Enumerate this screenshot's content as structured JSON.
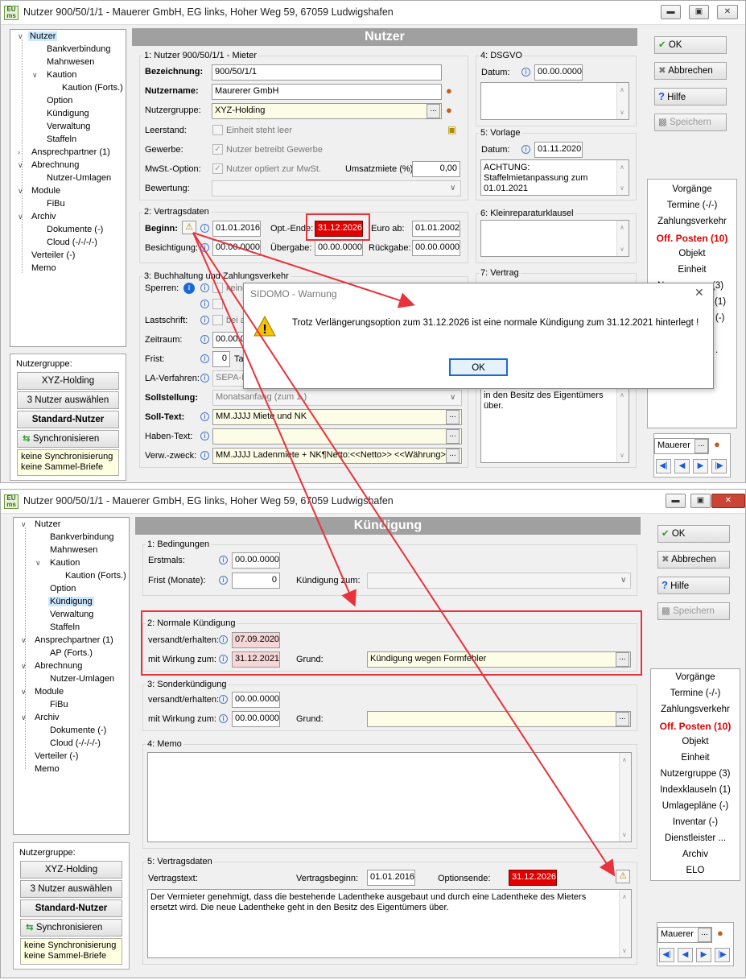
{
  "top_window": {
    "title": "Nutzer 900/50/1/1 - Mauerer GmbH, EG links, Hoher Weg 59, 67059 Ludwigshafen",
    "header": "Nutzer",
    "tree": [
      "Nutzer",
      "Bankverbindung",
      "Mahnwesen",
      "Kaution",
      "Kaution (Forts.)",
      "Option",
      "Kündigung",
      "Verwaltung",
      "Staffeln",
      "Ansprechpartner (1)",
      "Abrechnung",
      "Nutzer-Umlagen",
      "Module",
      "FiBu",
      "Archiv",
      "Dokumente (-)",
      "Cloud (-/-/-/-)",
      "Verteiler (-)",
      "Memo"
    ],
    "sec1": {
      "title": "1: Nutzer 900/50/1/1 - Mieter",
      "bezeichnung_label": "Bezeichnung:",
      "bezeichnung": "900/50/1/1",
      "nutzername_label": "Nutzername:",
      "nutzername": "Maurerer GmbH",
      "nutzergruppe_label": "Nutzergruppe:",
      "nutzergruppe": "XYZ-Holding",
      "leerstand_label": "Leerstand:",
      "leerstand_chk": "Einheit steht leer",
      "gewerbe_label": "Gewerbe:",
      "gewerbe_chk": "Nutzer betreibt Gewerbe",
      "mwst_label": "MwSt.-Option:",
      "mwst_chk": "Nutzer optiert zur MwSt.",
      "umsatzmiete_label": "Umsatzmiete (%):",
      "umsatzmiete": "0,00",
      "bewertung_label": "Bewertung:"
    },
    "sec2": {
      "title": "2: Vertragsdaten",
      "beginn_label": "Beginn:",
      "beginn": "01.01.2016",
      "optende_label": "Opt.-Ende:",
      "optende": "31.12.2026",
      "euroab_label": "Euro ab:",
      "euroab": "01.01.2002",
      "besichtigung_label": "Besichtigung:",
      "besichtigung": "00.00.0000",
      "uebergabe_label": "Übergabe:",
      "uebergabe": "00.00.0000",
      "rueckgabe_label": "Rückgabe:",
      "rueckgabe": "00.00.0000"
    },
    "sec3": {
      "title": "3: Buchhaltung und Zahlungsverkehr",
      "sperren_label": "Sperren:",
      "sperren_opt1": "keine",
      "lastschrift_label": "Lastschrift:",
      "lastschrift_opt": "bei a",
      "zeitraum_label": "Zeitraum:",
      "zeitraum": "00.00.0",
      "frist_label": "Frist:",
      "frist": "0",
      "frist_unit": "Ta",
      "laverfahren_label": "LA-Verfahren:",
      "laverfahren": "SEPA-B",
      "sollstellung_label": "Sollstellung:",
      "sollstellung": "Monatsanfang (zum 1.)",
      "solltext_label": "Soll-Text:",
      "solltext": "MM.JJJJ Miete und NK",
      "habentext_label": "Haben-Text:",
      "verwzweck_label": "Verw.-zweck:",
      "verwzweck": "MM.JJJJ Ladenmiete + NK¶Netto:<<Netto>> <<Währung>>"
    },
    "sec4": {
      "title": "4: DSGVO",
      "datum_label": "Datum:",
      "datum": "00.00.0000"
    },
    "sec5": {
      "title": "5: Vorlage",
      "datum_label": "Datum:",
      "datum": "01.11.2020",
      "text": "ACHTUNG: Staffelmietanpassung zum 01.01.2021"
    },
    "sec6": {
      "title": "6: Kleinreparaturklausel"
    },
    "sec7": {
      "title": "7: Vertrag",
      "text": "in den Besitz des Eigentümers über."
    },
    "buttons": {
      "ok": "OK",
      "abbrechen": "Abbrechen",
      "hilfe": "Hilfe",
      "speichern": "Speichern"
    },
    "links": [
      "Vorgänge",
      "Termine (-/-)",
      "Zahlungsverkehr",
      "Off. Posten (10)",
      "Objekt",
      "Einheit"
    ],
    "partial_links": [
      "Nu",
      "(3)",
      "(1)",
      "(-)",
      "."
    ],
    "search": "Mauerer",
    "group_panel": {
      "label": "Nutzergruppe:",
      "group": "XYZ-Holding",
      "select_btn": "3 Nutzer auswählen",
      "std_btn": "Standard-Nutzer",
      "sync_btn": "Synchronisieren",
      "note": "keine Synchronisierung keine Sammel-Briefe"
    }
  },
  "dialog": {
    "title": "SIDOMO - Warnung",
    "message": "Trotz Verlängerungsoption zum 31.12.2026 ist eine normale Kündigung zum 31.12.2021 hinterlegt !",
    "ok": "OK"
  },
  "bottom_window": {
    "title": "Nutzer 900/50/1/1 - Mauerer GmbH, EG links, Hoher Weg 59, 67059 Ludwigshafen",
    "header": "Kündigung",
    "tree": [
      "Nutzer",
      "Bankverbindung",
      "Mahnwesen",
      "Kaution",
      "Kaution (Forts.)",
      "Option",
      "Kündigung",
      "Verwaltung",
      "Staffeln",
      "Ansprechpartner (1)",
      "AP (Forts.)",
      "Abrechnung",
      "Nutzer-Umlagen",
      "Module",
      "FiBu",
      "Archiv",
      "Dokumente (-)",
      "Cloud (-/-/-/-)",
      "Verteiler (-)",
      "Memo"
    ],
    "sec1": {
      "title": "1: Bedingungen",
      "erstmals_label": "Erstmals:",
      "erstmals": "00.00.0000",
      "frist_label": "Frist (Monate):",
      "frist": "0",
      "kuendigung_zum_label": "Kündigung zum:"
    },
    "sec2": {
      "title": "2: Normale Kündigung",
      "versandt_label": "versandt/erhalten:",
      "versandt": "07.09.2020",
      "wirkung_label": "mit Wirkung zum:",
      "wirkung": "31.12.2021",
      "grund_label": "Grund:",
      "grund": "Kündigung wegen Formfehler"
    },
    "sec3": {
      "title": "3: Sonderkündigung",
      "versandt_label": "versandt/erhalten:",
      "versandt": "00.00.0000",
      "wirkung_label": "mit Wirkung zum:",
      "wirkung": "00.00.0000",
      "grund_label": "Grund:"
    },
    "sec4": {
      "title": "4: Memo"
    },
    "sec5": {
      "title": "5: Vertragsdaten",
      "vertragstext_label": "Vertragstext:",
      "vertragsbeginn_label": "Vertragsbeginn:",
      "vertragsbeginn": "01.01.2016",
      "optionsende_label": "Optionsende:",
      "optionsende": "31.12.2026",
      "text": "Der Vermieter genehmigt, dass die bestehende Ladentheke ausgebaut und durch eine Ladentheke des Mieters ersetzt wird. Die neue Ladentheke geht in den Besitz des Eigentümers über."
    },
    "buttons": {
      "ok": "OK",
      "abbrechen": "Abbrechen",
      "hilfe": "Hilfe",
      "speichern": "Speichern"
    },
    "links": [
      "Vorgänge",
      "Termine (-/-)",
      "Zahlungsverkehr",
      "Off. Posten (10)",
      "Objekt",
      "Einheit",
      "Nutzergruppe (3)",
      "Indexklauseln (1)",
      "Umlagepläne (-)",
      "Inventar (-)",
      "Dienstleister ...",
      "Archiv",
      "ELO"
    ],
    "search": "Mauerer",
    "group_panel": {
      "label": "Nutzergruppe:",
      "group": "XYZ-Holding",
      "select_btn": "3 Nutzer auswählen",
      "std_btn": "Standard-Nutzer",
      "sync_btn": "Synchronisieren",
      "note": "keine Synchronisierung keine Sammel-Briefe"
    }
  },
  "colors": {
    "alert_red": "#e00000",
    "annotation_red": "#e8323c",
    "header_gray": "#a0a0a0"
  }
}
